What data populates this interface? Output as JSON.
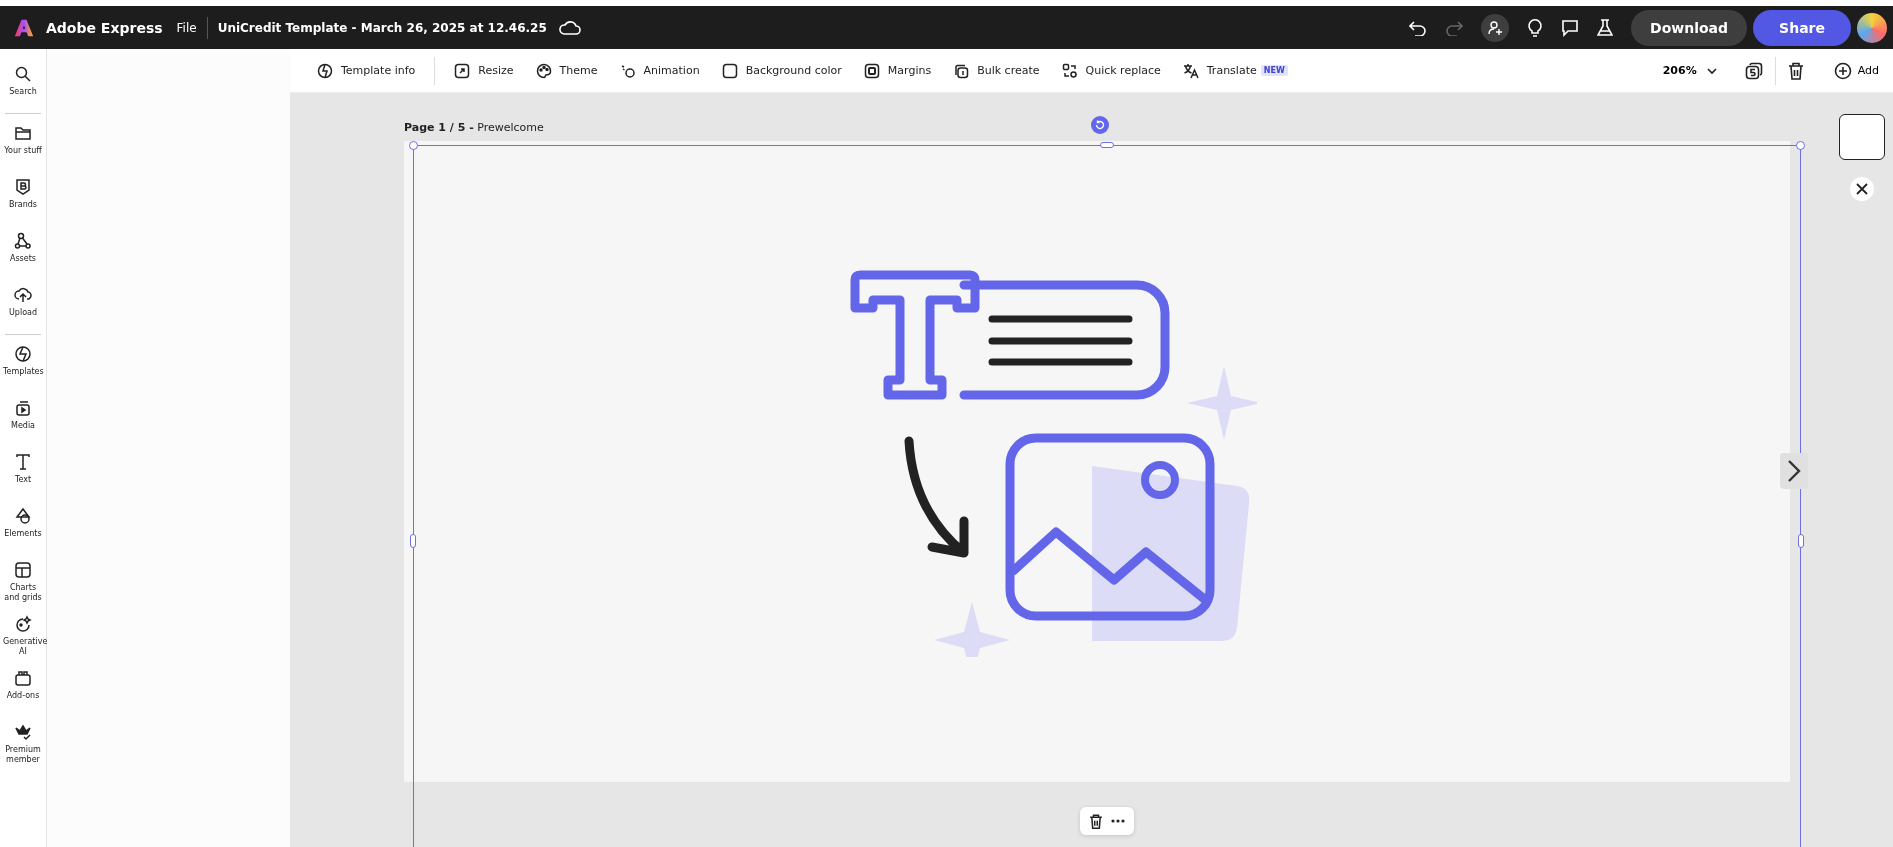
{
  "header": {
    "app_name": "Adobe Express",
    "menu": "File",
    "document_title": "UniCredit Template - March 26, 2025 at 12.46.25",
    "buttons": [
      {
        "label": "Download",
        "kind": "secondary"
      },
      {
        "label": "Share",
        "kind": "primary"
      }
    ]
  },
  "sidebar": {
    "groups": [
      [
        {
          "label": "Search"
        }
      ],
      [
        {
          "label": "Your stuff"
        },
        {
          "label": "Brands"
        },
        {
          "label": "Assets"
        },
        {
          "label": "Upload"
        }
      ],
      [
        {
          "label": "Templates"
        },
        {
          "label": "Media"
        },
        {
          "label": "Text"
        },
        {
          "label": "Elements"
        },
        {
          "label": "Charts and grids"
        },
        {
          "label": "Generative AI"
        },
        {
          "label": "Add-ons"
        },
        {
          "label": "Premium member"
        }
      ]
    ]
  },
  "toolbar": {
    "items": [
      {
        "label": "Template info"
      },
      {
        "label": "Resize"
      },
      {
        "label": "Theme"
      },
      {
        "label": "Animation"
      },
      {
        "label": "Background color"
      },
      {
        "label": "Margins"
      },
      {
        "label": "Bulk create"
      },
      {
        "label": "Quick replace"
      },
      {
        "label": "Translate",
        "badge": "NEW"
      }
    ],
    "zoom": "206%",
    "add": "Add"
  },
  "page": {
    "label": "**Page 1 / 5 -** Prewelcome"
  }
}
